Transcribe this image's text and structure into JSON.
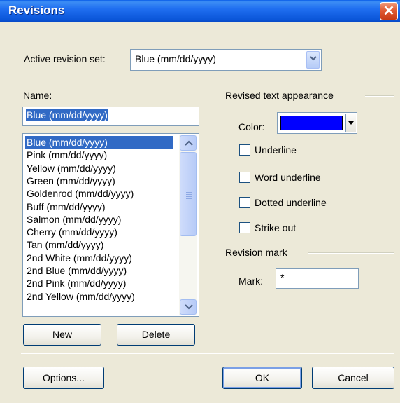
{
  "window": {
    "title": "Revisions",
    "close_label": "✕"
  },
  "active_set": {
    "label": "Active revision set:",
    "value": "Blue (mm/dd/yyyy)"
  },
  "name": {
    "label": "Name:",
    "value": "Blue (mm/dd/yyyy)",
    "list": [
      "Blue (mm/dd/yyyy)",
      "Pink (mm/dd/yyyy)",
      "Yellow (mm/dd/yyyy)",
      "Green (mm/dd/yyyy)",
      "Goldenrod (mm/dd/yyyy)",
      "Buff (mm/dd/yyyy)",
      "Salmon (mm/dd/yyyy)",
      "Cherry (mm/dd/yyyy)",
      "Tan (mm/dd/yyyy)",
      "2nd White (mm/dd/yyyy)",
      "2nd Blue (mm/dd/yyyy)",
      "2nd Pink (mm/dd/yyyy)",
      "2nd Yellow (mm/dd/yyyy)"
    ],
    "selected_index": 0
  },
  "appearance": {
    "heading": "Revised text appearance",
    "color_label": "Color:",
    "color_value": "#0000ff",
    "options": [
      {
        "label": "Underline",
        "checked": false
      },
      {
        "label": "Word underline",
        "checked": false
      },
      {
        "label": "Dotted underline",
        "checked": false
      },
      {
        "label": "Strike out",
        "checked": false
      }
    ]
  },
  "revision_mark": {
    "heading": "Revision mark",
    "mark_label": "Mark:",
    "mark_value": "*"
  },
  "buttons": {
    "new": "New",
    "delete": "Delete",
    "options": "Options...",
    "ok": "OK",
    "cancel": "Cancel"
  }
}
